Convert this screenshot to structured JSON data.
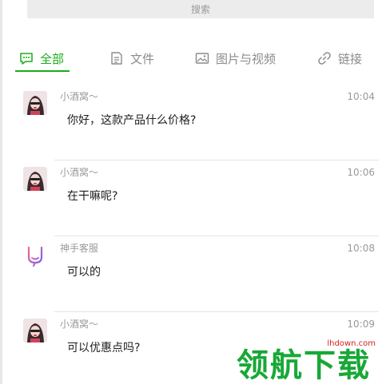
{
  "search": {
    "placeholder": "搜索"
  },
  "tabs": [
    {
      "label": "全部",
      "icon": "chat-bubble-icon",
      "active": true
    },
    {
      "label": "文件",
      "icon": "document-icon",
      "active": false
    },
    {
      "label": "图片与视频",
      "icon": "image-icon",
      "active": false
    },
    {
      "label": "链接",
      "icon": "link-icon",
      "active": false
    }
  ],
  "messages": [
    {
      "sender": "小酒窝～",
      "time": "10:04",
      "text": "你好，这款产品什么价格?",
      "avatar": "user-avatar"
    },
    {
      "sender": "小酒窝～",
      "time": "10:06",
      "text": "在干嘛呢?",
      "avatar": "user-avatar"
    },
    {
      "sender": "神手客服",
      "time": "10:08",
      "text": "可以的",
      "avatar": "service-logo"
    },
    {
      "sender": "小酒窝～",
      "time": "10:09",
      "text": "可以优惠点吗?",
      "avatar": "user-avatar"
    }
  ],
  "watermark": {
    "text": "领航下载",
    "url": "lhdown.com"
  },
  "colors": {
    "accent": "#1aad19",
    "muted": "#9a9a9a",
    "watermark_green": "#18a836",
    "watermark_red": "#d4221b"
  }
}
